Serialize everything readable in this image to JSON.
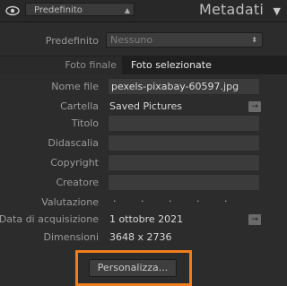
{
  "header": {
    "preset_select_value": "Predefinito",
    "title": "Metadati",
    "eye_icon": "eye-icon",
    "collapse_icon": "triangle-down-icon"
  },
  "preset": {
    "label": "Predefinito",
    "value": "Nessuno"
  },
  "tabs": [
    {
      "label": "Foto finale",
      "active": false
    },
    {
      "label": "Foto selezionate",
      "active": true
    }
  ],
  "fields": {
    "filename": {
      "label": "Nome file",
      "value": "pexels-pixabay-60597.jpg"
    },
    "folder": {
      "label": "Cartella",
      "value": "Saved Pictures"
    },
    "title": {
      "label": "Titolo",
      "value": ""
    },
    "caption": {
      "label": "Didascalia",
      "value": ""
    },
    "copyright": {
      "label": "Copyright",
      "value": ""
    },
    "creator": {
      "label": "Creatore",
      "value": ""
    },
    "rating": {
      "label": "Valutazione",
      "value": "· · · · ·"
    },
    "capture_date": {
      "label": "Data di acquisizione",
      "value": "1 ottobre 2021"
    },
    "dimensions": {
      "label": "Dimensioni",
      "value": "3648 x 2736"
    }
  },
  "buttons": {
    "customize_label": "Personalizza..."
  },
  "colors": {
    "highlight": "#f07d1a",
    "background": "#2c2c2c"
  }
}
